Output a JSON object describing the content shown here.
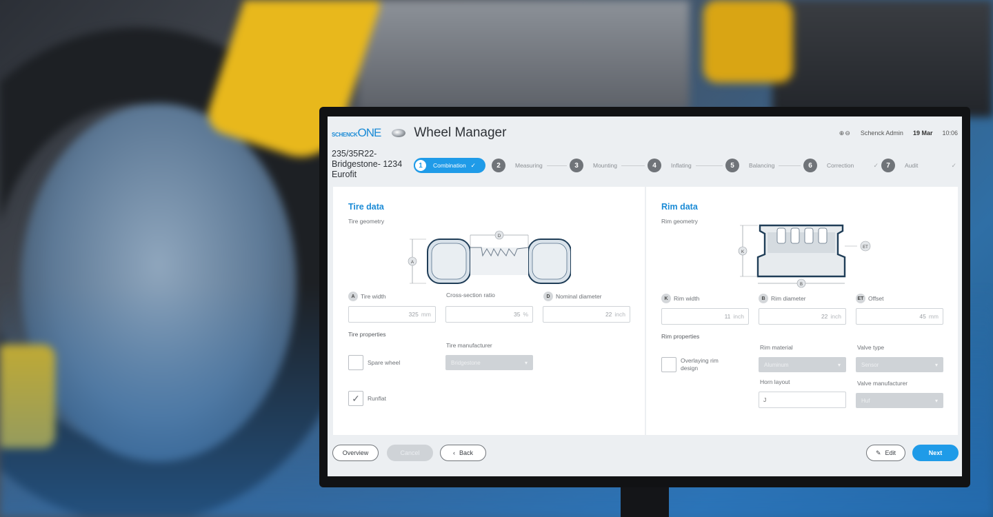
{
  "header": {
    "brand_small": "SCHENCK",
    "brand_large": "ONE",
    "app_title": "Wheel Manager",
    "status_icons": "⊕⊖",
    "user": "Schenck Admin",
    "date": "19 Mar",
    "time": "10:06"
  },
  "order": {
    "line1": "235/35R22-",
    "line2": "Bridgestone- 1234",
    "line3": "Eurofit"
  },
  "steps": [
    {
      "num": "1",
      "label": "Combination",
      "check": "✓"
    },
    {
      "num": "2",
      "label": "Measuring",
      "check": ""
    },
    {
      "num": "3",
      "label": "Mounting",
      "check": ""
    },
    {
      "num": "4",
      "label": "Inflating",
      "check": ""
    },
    {
      "num": "5",
      "label": "Balancing",
      "check": ""
    },
    {
      "num": "6",
      "label": "Correction",
      "check": "✓"
    },
    {
      "num": "7",
      "label": "Audit",
      "check": "✓"
    }
  ],
  "tire": {
    "title": "Tire data",
    "geometry_label": "Tire geometry",
    "width": {
      "badge": "A",
      "label": "Tire width",
      "value": "325",
      "unit": "mm"
    },
    "ratio": {
      "label": "Cross-section ratio",
      "value": "35",
      "unit": "%"
    },
    "diameter": {
      "badge": "D",
      "label": "Nominal diameter",
      "value": "22",
      "unit": "inch"
    },
    "properties_label": "Tire properties",
    "spare_wheel": {
      "label": "Spare wheel",
      "checked": false
    },
    "runflat": {
      "label": "Runflat",
      "checked": true
    },
    "manufacturer": {
      "label": "Tire manufacturer",
      "value": "Bridgestone"
    }
  },
  "rim": {
    "title": "Rim data",
    "geometry_label": "Rim geometry",
    "width": {
      "badge": "K",
      "label": "Rim width",
      "value": "11",
      "unit": "inch"
    },
    "diameter": {
      "badge": "B",
      "label": "Rim diameter",
      "value": "22",
      "unit": "inch"
    },
    "offset": {
      "badge": "ET",
      "label": "Offset",
      "value": "45",
      "unit": "mm"
    },
    "properties_label": "Rim properties",
    "overlaying": {
      "label_line1": "Overlaying rim",
      "label_line2": "design",
      "checked": false
    },
    "material": {
      "label": "Rim material",
      "value": "Aluminum"
    },
    "valve_type": {
      "label": "Valve type",
      "value": "Sensor"
    },
    "horn_layout": {
      "label": "Horn layout",
      "value": "J"
    },
    "valve_manufacturer": {
      "label": "Valve manufacturer",
      "value": "Huf"
    }
  },
  "footer": {
    "overview": "Overview",
    "cancel": "Cancel",
    "back": "Back",
    "edit": "Edit",
    "next": "Next"
  },
  "colors": {
    "accent": "#1f9be8",
    "panel": "#ffffff",
    "screen_bg": "#eceff2"
  }
}
